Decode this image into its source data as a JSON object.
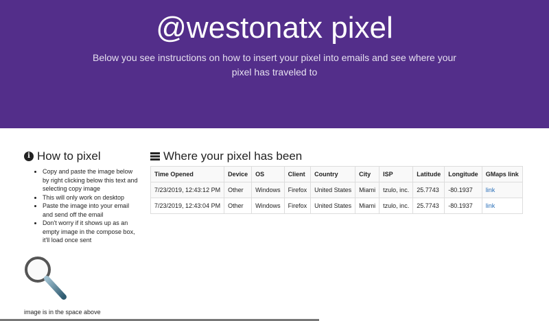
{
  "header": {
    "title": "@westonatx pixel",
    "subtitle": "Below you see instructions on how to insert your pixel into emails and see where your pixel has traveled to"
  },
  "howto": {
    "title": "How to pixel",
    "steps": [
      "Copy and paste the image below by right clicking below this text and selecting copy image",
      "This will only work on desktop",
      "Paste the image into your email and send off the email",
      "Don't worry if it shows up as an empty image in the compose box, it'll load once sent"
    ],
    "caption": "image is in the space above"
  },
  "table": {
    "title": "Where your pixel has been",
    "columns": [
      "Time Opened",
      "Device",
      "OS",
      "Client",
      "Country",
      "City",
      "ISP",
      "Latitude",
      "Longitude",
      "GMaps link"
    ],
    "rows": [
      [
        "7/23/2019, 12:43:12 PM",
        "Other",
        "Windows",
        "Firefox",
        "United States",
        "Miami",
        "tzulo, inc.",
        "25.7743",
        "-80.1937",
        "link"
      ],
      [
        "7/23/2019, 12:43:04 PM",
        "Other",
        "Windows",
        "Firefox",
        "United States",
        "Miami",
        "tzulo, inc.",
        "25.7743",
        "-80.1937",
        "link"
      ]
    ]
  },
  "colors": {
    "header_bg": "#532e8a",
    "link": "#2a6fb8"
  }
}
